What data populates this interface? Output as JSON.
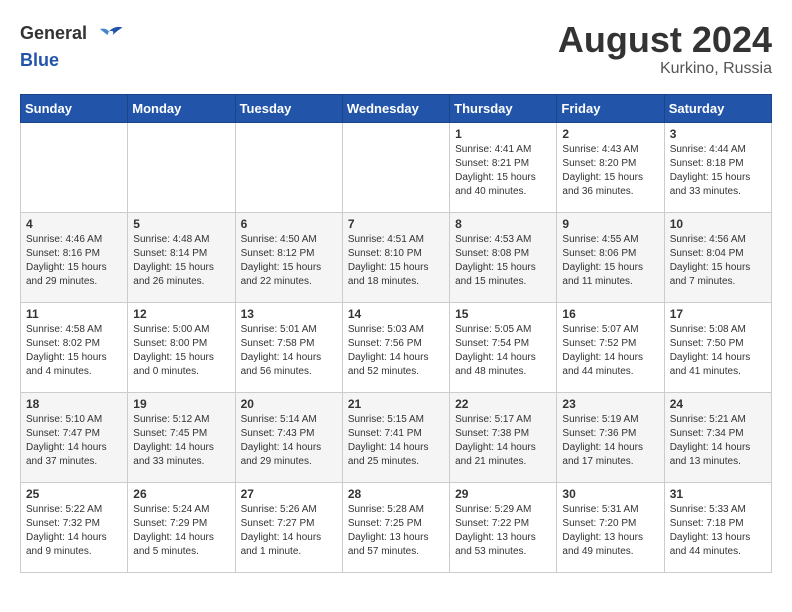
{
  "header": {
    "logo_general": "General",
    "logo_blue": "Blue",
    "month_year": "August 2024",
    "location": "Kurkino, Russia"
  },
  "days_of_week": [
    "Sunday",
    "Monday",
    "Tuesday",
    "Wednesday",
    "Thursday",
    "Friday",
    "Saturday"
  ],
  "weeks": [
    [
      {
        "day": "",
        "info": ""
      },
      {
        "day": "",
        "info": ""
      },
      {
        "day": "",
        "info": ""
      },
      {
        "day": "",
        "info": ""
      },
      {
        "day": "1",
        "info": "Sunrise: 4:41 AM\nSunset: 8:21 PM\nDaylight: 15 hours\nand 40 minutes."
      },
      {
        "day": "2",
        "info": "Sunrise: 4:43 AM\nSunset: 8:20 PM\nDaylight: 15 hours\nand 36 minutes."
      },
      {
        "day": "3",
        "info": "Sunrise: 4:44 AM\nSunset: 8:18 PM\nDaylight: 15 hours\nand 33 minutes."
      }
    ],
    [
      {
        "day": "4",
        "info": "Sunrise: 4:46 AM\nSunset: 8:16 PM\nDaylight: 15 hours\nand 29 minutes."
      },
      {
        "day": "5",
        "info": "Sunrise: 4:48 AM\nSunset: 8:14 PM\nDaylight: 15 hours\nand 26 minutes."
      },
      {
        "day": "6",
        "info": "Sunrise: 4:50 AM\nSunset: 8:12 PM\nDaylight: 15 hours\nand 22 minutes."
      },
      {
        "day": "7",
        "info": "Sunrise: 4:51 AM\nSunset: 8:10 PM\nDaylight: 15 hours\nand 18 minutes."
      },
      {
        "day": "8",
        "info": "Sunrise: 4:53 AM\nSunset: 8:08 PM\nDaylight: 15 hours\nand 15 minutes."
      },
      {
        "day": "9",
        "info": "Sunrise: 4:55 AM\nSunset: 8:06 PM\nDaylight: 15 hours\nand 11 minutes."
      },
      {
        "day": "10",
        "info": "Sunrise: 4:56 AM\nSunset: 8:04 PM\nDaylight: 15 hours\nand 7 minutes."
      }
    ],
    [
      {
        "day": "11",
        "info": "Sunrise: 4:58 AM\nSunset: 8:02 PM\nDaylight: 15 hours\nand 4 minutes."
      },
      {
        "day": "12",
        "info": "Sunrise: 5:00 AM\nSunset: 8:00 PM\nDaylight: 15 hours\nand 0 minutes."
      },
      {
        "day": "13",
        "info": "Sunrise: 5:01 AM\nSunset: 7:58 PM\nDaylight: 14 hours\nand 56 minutes."
      },
      {
        "day": "14",
        "info": "Sunrise: 5:03 AM\nSunset: 7:56 PM\nDaylight: 14 hours\nand 52 minutes."
      },
      {
        "day": "15",
        "info": "Sunrise: 5:05 AM\nSunset: 7:54 PM\nDaylight: 14 hours\nand 48 minutes."
      },
      {
        "day": "16",
        "info": "Sunrise: 5:07 AM\nSunset: 7:52 PM\nDaylight: 14 hours\nand 44 minutes."
      },
      {
        "day": "17",
        "info": "Sunrise: 5:08 AM\nSunset: 7:50 PM\nDaylight: 14 hours\nand 41 minutes."
      }
    ],
    [
      {
        "day": "18",
        "info": "Sunrise: 5:10 AM\nSunset: 7:47 PM\nDaylight: 14 hours\nand 37 minutes."
      },
      {
        "day": "19",
        "info": "Sunrise: 5:12 AM\nSunset: 7:45 PM\nDaylight: 14 hours\nand 33 minutes."
      },
      {
        "day": "20",
        "info": "Sunrise: 5:14 AM\nSunset: 7:43 PM\nDaylight: 14 hours\nand 29 minutes."
      },
      {
        "day": "21",
        "info": "Sunrise: 5:15 AM\nSunset: 7:41 PM\nDaylight: 14 hours\nand 25 minutes."
      },
      {
        "day": "22",
        "info": "Sunrise: 5:17 AM\nSunset: 7:38 PM\nDaylight: 14 hours\nand 21 minutes."
      },
      {
        "day": "23",
        "info": "Sunrise: 5:19 AM\nSunset: 7:36 PM\nDaylight: 14 hours\nand 17 minutes."
      },
      {
        "day": "24",
        "info": "Sunrise: 5:21 AM\nSunset: 7:34 PM\nDaylight: 14 hours\nand 13 minutes."
      }
    ],
    [
      {
        "day": "25",
        "info": "Sunrise: 5:22 AM\nSunset: 7:32 PM\nDaylight: 14 hours\nand 9 minutes."
      },
      {
        "day": "26",
        "info": "Sunrise: 5:24 AM\nSunset: 7:29 PM\nDaylight: 14 hours\nand 5 minutes."
      },
      {
        "day": "27",
        "info": "Sunrise: 5:26 AM\nSunset: 7:27 PM\nDaylight: 14 hours\nand 1 minute."
      },
      {
        "day": "28",
        "info": "Sunrise: 5:28 AM\nSunset: 7:25 PM\nDaylight: 13 hours\nand 57 minutes."
      },
      {
        "day": "29",
        "info": "Sunrise: 5:29 AM\nSunset: 7:22 PM\nDaylight: 13 hours\nand 53 minutes."
      },
      {
        "day": "30",
        "info": "Sunrise: 5:31 AM\nSunset: 7:20 PM\nDaylight: 13 hours\nand 49 minutes."
      },
      {
        "day": "31",
        "info": "Sunrise: 5:33 AM\nSunset: 7:18 PM\nDaylight: 13 hours\nand 44 minutes."
      }
    ]
  ]
}
